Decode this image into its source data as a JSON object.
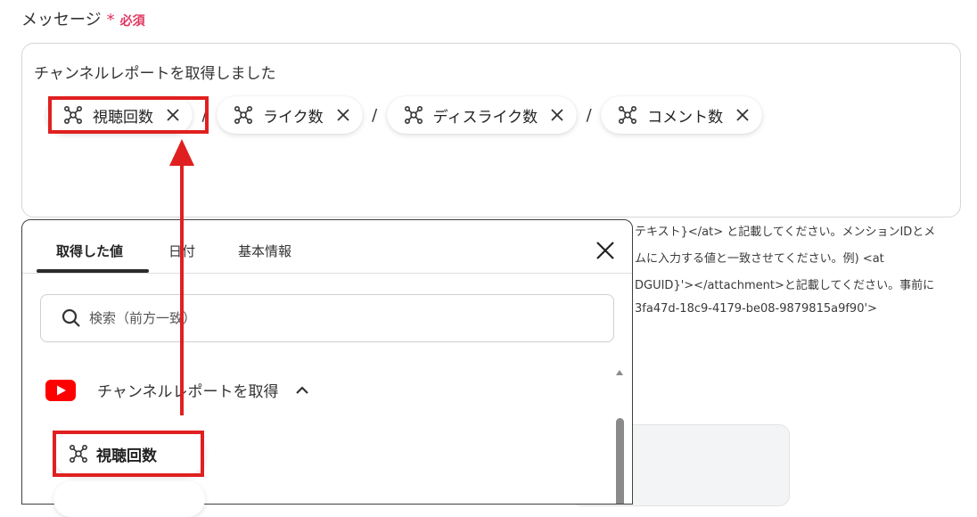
{
  "field": {
    "label": "メッセージ",
    "required_star": "*",
    "required_text": "必須"
  },
  "message": {
    "text": "チャンネルレポートを取得しました",
    "separator": "/",
    "chips": [
      {
        "label": "視聴回数"
      },
      {
        "label": "ライク数"
      },
      {
        "label": "ディスライク数"
      },
      {
        "label": "コメント数"
      }
    ]
  },
  "help_lines": [
    "テキスト}</at> と記載してください。メンションIDとメ",
    "ムに入力する値と一致させてください。例) <at",
    "DGUID}'></attachment>と記載してください。事前に",
    "3fa47d-18c9-4179-be08-9879815a9f90'>"
  ],
  "panel": {
    "tabs": [
      {
        "label": "取得した値",
        "active": true
      },
      {
        "label": "日付",
        "active": false
      },
      {
        "label": "基本情報",
        "active": false
      }
    ],
    "search_placeholder": "検索（前方一致）",
    "section_title": "チャンネルレポートを取得",
    "item_label": "視聴回数"
  },
  "colors": {
    "accent_red": "#e02020",
    "required": "#e0355f",
    "youtube": "#ff0000"
  },
  "icons": [
    "hub-icon",
    "close-icon",
    "search-icon",
    "youtube-logo-icon",
    "chevron-up-icon"
  ]
}
